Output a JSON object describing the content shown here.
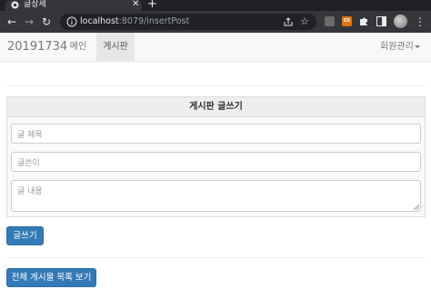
{
  "browser": {
    "tab_title": "글상세",
    "url_host": "localhost",
    "url_rest": ":8079/insertPost",
    "ext_label": "EX"
  },
  "navbar": {
    "brand": "20191734",
    "main": "메인",
    "board": "게시판",
    "member": "회원관리"
  },
  "form": {
    "header": "게시판 글쓰기",
    "title_placeholder": "글 제목",
    "author_placeholder": "글쓴이",
    "content_placeholder": "글 내용",
    "submit_label": "글쓰기"
  },
  "footer": {
    "list_label": "전체 게시물 목록 보기"
  },
  "colors": {
    "primary": "#337ab7",
    "navbar_bg": "#f8f8f8",
    "chrome_dark": "#35363a"
  }
}
